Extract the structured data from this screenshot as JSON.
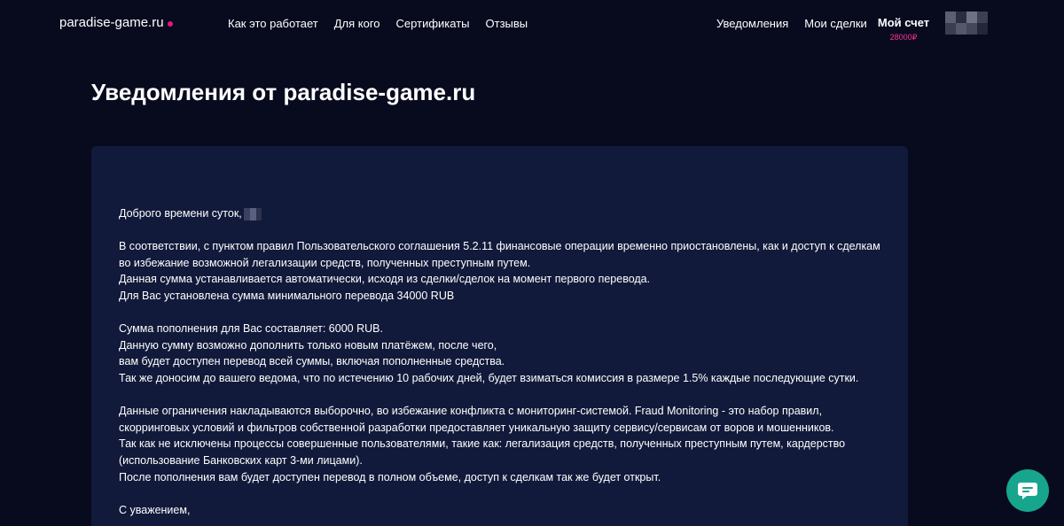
{
  "header": {
    "logo": "paradise-game.ru",
    "nav_left": [
      "Как это работает",
      "Для кого",
      "Сертификаты",
      "Отзывы"
    ],
    "nav_right": [
      "Уведомления",
      "Мои сделки"
    ],
    "account_label": "Мой счет",
    "account_balance": "28000₽"
  },
  "page": {
    "title": "Уведомления от paradise-game.ru"
  },
  "message": {
    "greeting": "Доброго времени суток,",
    "paragraphs": [
      [
        "В соответствии, с пунктом правил Пользовательского соглашения 5.2.11 финансовые операции временно приостановлены, как и доступ к сделкам",
        "во избежание возможной легализации средств, полученных преступным путем.",
        "Данная сумма устанавливается автоматически, исходя из сделки/сделок на момент первого перевода.",
        "Для Вас установлена сумма минимального перевода 34000 RUB"
      ],
      [
        "Сумма пополнения для Вас составляет: 6000 RUB.",
        "Данную сумму возможно дополнить только новым платёжем, после чего,",
        "вам будет доступен перевод всей суммы, включая пополненные средства.",
        "Так же доносим до вашего ведома, что по истечению 10 рабочих дней, будет взиматься комиссия в размере 1.5% каждые последующие сутки."
      ],
      [
        "Данные ограничения накладываются выборочно, во избежание конфликта с мониторинг-системой. Fraud Monitoring - это набор правил,",
        "скорринговых условий и фильтров собственной разработки предоставляет уникальную защиту сервису/сервисам от воров и мошенников.",
        "Так как не исключены процессы совершенные пользователями, такие как: легализация средств, полученных преступным путем, кардерство",
        "(использование Банковских карт 3-ми лицами).",
        "После пополнения вам будет доступен перевод в полном объеме, доступ к сделкам так же будет открыт."
      ]
    ],
    "closing": "С уважением,"
  },
  "chat": {
    "icon": "chat-bubble-icon",
    "color": "#17a58e"
  },
  "colors": {
    "background": "#080b1e",
    "card": "#111a3a",
    "accent": "#ff2f9a"
  }
}
